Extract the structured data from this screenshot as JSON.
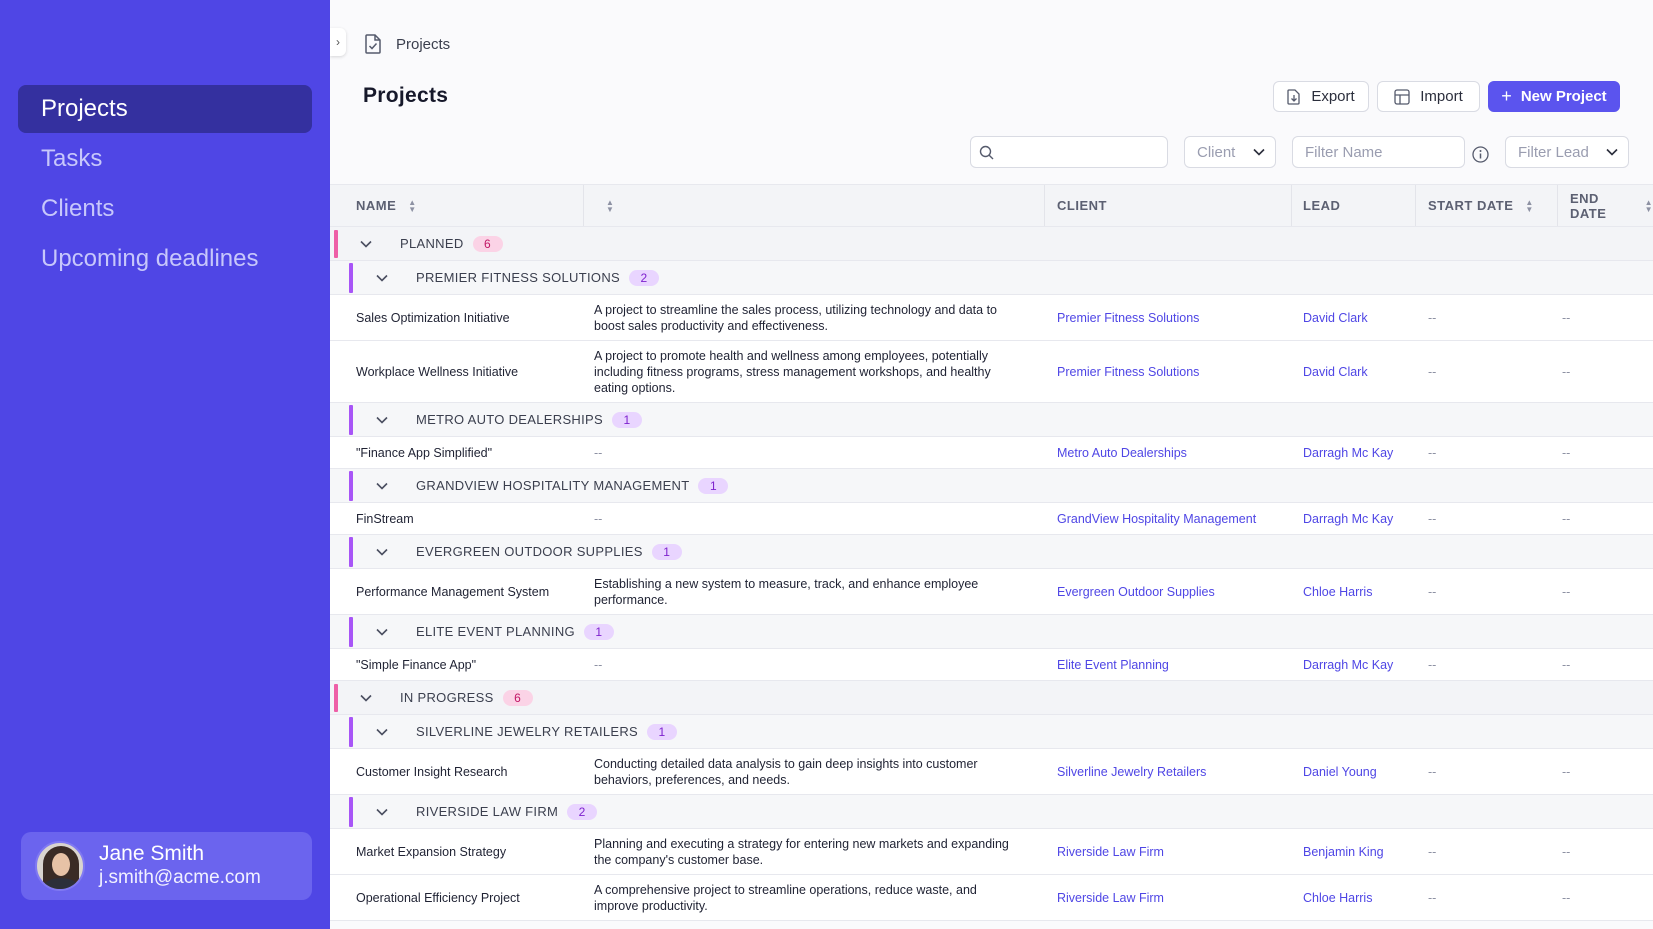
{
  "sidebar": {
    "items": [
      {
        "label": "Projects"
      },
      {
        "label": "Tasks"
      },
      {
        "label": "Clients"
      },
      {
        "label": "Upcoming deadlines"
      }
    ],
    "user": {
      "name": "Jane Smith",
      "email": "j.smith@acme.com"
    }
  },
  "breadcrumb": {
    "label": "Projects"
  },
  "page": {
    "title": "Projects"
  },
  "toolbar": {
    "export_label": "Export",
    "import_label": "Import",
    "new_project_label": "New Project"
  },
  "filters": {
    "search_placeholder": "",
    "client_label": "Client",
    "name_placeholder": "Filter Name",
    "lead_label": "Filter Lead"
  },
  "table": {
    "headers": {
      "name": "NAME",
      "description": "",
      "client": "CLIENT",
      "lead": "LEAD",
      "start_date": "START DATE",
      "end_date": "END DATE"
    },
    "groups": [
      {
        "status": "PLANNED",
        "count": "6",
        "clients": [
          {
            "client": "PREMIER FITNESS SOLUTIONS",
            "count": "2",
            "rows": [
              {
                "name": "Sales Optimization Initiative",
                "description": "A project to streamline the sales process, utilizing technology and data to boost sales productivity and effectiveness.",
                "client": "Premier Fitness Solutions",
                "lead": "David Clark",
                "start": "--",
                "end": "--"
              },
              {
                "name": "Workplace Wellness Initiative",
                "description": "A project to promote health and wellness among employees, potentially including fitness programs, stress management workshops, and healthy eating options.",
                "client": "Premier Fitness Solutions",
                "lead": "David Clark",
                "start": "--",
                "end": "--"
              }
            ]
          },
          {
            "client": "METRO AUTO DEALERSHIPS",
            "count": "1",
            "rows": [
              {
                "name": "\"Finance App Simplified\"",
                "description": "--",
                "client": "Metro Auto Dealerships",
                "lead": "Darragh Mc Kay",
                "start": "--",
                "end": "--"
              }
            ]
          },
          {
            "client": "GRANDVIEW HOSPITALITY MANAGEMENT",
            "count": "1",
            "rows": [
              {
                "name": "FinStream",
                "description": "--",
                "client": "GrandView Hospitality Management",
                "lead": "Darragh Mc Kay",
                "start": "--",
                "end": "--"
              }
            ]
          },
          {
            "client": "EVERGREEN OUTDOOR SUPPLIES",
            "count": "1",
            "rows": [
              {
                "name": "Performance Management System",
                "description": "Establishing a new system to measure, track, and enhance employee performance.",
                "client": "Evergreen Outdoor Supplies",
                "lead": "Chloe Harris",
                "start": "--",
                "end": "--"
              }
            ]
          },
          {
            "client": "ELITE EVENT PLANNING",
            "count": "1",
            "rows": [
              {
                "name": "\"Simple Finance App\"",
                "description": "--",
                "client": "Elite Event Planning",
                "lead": "Darragh Mc Kay",
                "start": "--",
                "end": "--"
              }
            ]
          }
        ]
      },
      {
        "status": "IN PROGRESS",
        "count": "6",
        "clients": [
          {
            "client": "SILVERLINE JEWELRY RETAILERS",
            "count": "1",
            "rows": [
              {
                "name": "Customer Insight Research",
                "description": "Conducting detailed data analysis to gain deep insights into customer behaviors, preferences, and needs.",
                "client": "Silverline Jewelry Retailers",
                "lead": "Daniel Young",
                "start": "--",
                "end": "--"
              }
            ]
          },
          {
            "client": "RIVERSIDE LAW FIRM",
            "count": "2",
            "rows": [
              {
                "name": "Market Expansion Strategy",
                "description": "Planning and executing a strategy for entering new markets and expanding the company's customer base.",
                "client": "Riverside Law Firm",
                "lead": "Benjamin King",
                "start": "--",
                "end": "--"
              },
              {
                "name": "Operational Efficiency Project",
                "description": "A comprehensive project to streamline operations, reduce waste, and improve productivity.",
                "client": "Riverside Law Firm",
                "lead": "Chloe Harris",
                "start": "--",
                "end": "--"
              }
            ]
          }
        ]
      }
    ]
  },
  "colors": {
    "sidebar": "#4f46e5",
    "sidebar_active": "#34309f",
    "primary": "#5b54ee",
    "status_bar": "#ee5fa7",
    "client_bar": "#a855f7"
  }
}
